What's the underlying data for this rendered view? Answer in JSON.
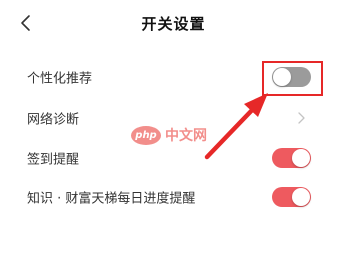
{
  "header": {
    "title": "开关设置",
    "back_icon": "chevron-left-icon"
  },
  "settings": [
    {
      "label": "个性化推荐",
      "control": "toggle",
      "state": "off"
    },
    {
      "label": "网络诊断",
      "control": "chevron",
      "icon": "chevron-right-icon"
    },
    {
      "label": "签到提醒",
      "control": "toggle",
      "state": "on"
    },
    {
      "label": "知识 · 财富天梯每日进度提醒",
      "control": "toggle",
      "state": "on"
    }
  ],
  "annotation": {
    "highlight_color": "#e62828",
    "arrow_color": "#e62828"
  },
  "watermark": {
    "logo_text": "php",
    "text": "中文网"
  },
  "colors": {
    "toggle_on": "#ee5a5f",
    "toggle_off": "#9b9b9b",
    "background": "#ffffff"
  }
}
